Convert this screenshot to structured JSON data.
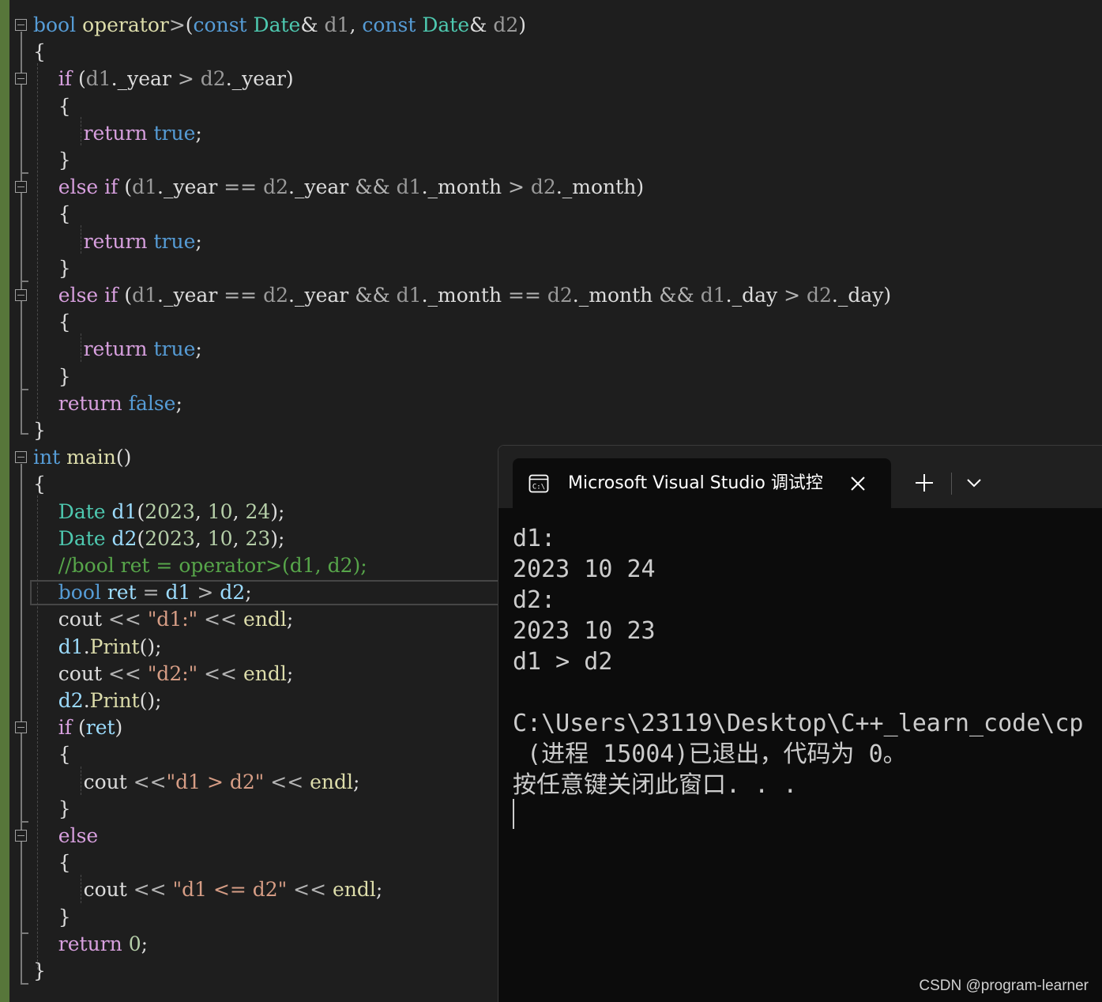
{
  "editor": {
    "lines": [
      [
        [
          "kw",
          "bool"
        ],
        [
          "plain",
          " "
        ],
        [
          "fn",
          "operator"
        ],
        [
          "op",
          ">"
        ],
        [
          "plain",
          "("
        ],
        [
          "kw",
          "const"
        ],
        [
          "plain",
          " "
        ],
        [
          "typ",
          "Date"
        ],
        [
          "plain",
          "& "
        ],
        [
          "par",
          "d1"
        ],
        [
          "plain",
          ", "
        ],
        [
          "kw",
          "const"
        ],
        [
          "plain",
          " "
        ],
        [
          "typ",
          "Date"
        ],
        [
          "plain",
          "& "
        ],
        [
          "par",
          "d2"
        ],
        [
          "plain",
          ")"
        ]
      ],
      [
        [
          "plain",
          "{"
        ]
      ],
      [
        [
          "plain",
          "    "
        ],
        [
          "ctl",
          "if"
        ],
        [
          "plain",
          " ("
        ],
        [
          "par",
          "d1"
        ],
        [
          "plain",
          "."
        ],
        [
          "plain",
          "_year"
        ],
        [
          "plain",
          " "
        ],
        [
          "op",
          ">"
        ],
        [
          "plain",
          " "
        ],
        [
          "par",
          "d2"
        ],
        [
          "plain",
          "."
        ],
        [
          "plain",
          "_year"
        ],
        [
          "plain",
          ")"
        ]
      ],
      [
        [
          "plain",
          "    {"
        ]
      ],
      [
        [
          "plain",
          "        "
        ],
        [
          "ctl",
          "return"
        ],
        [
          "plain",
          " "
        ],
        [
          "kw",
          "true"
        ],
        [
          "plain",
          ";"
        ]
      ],
      [
        [
          "plain",
          "    }"
        ]
      ],
      [
        [
          "plain",
          "    "
        ],
        [
          "ctl",
          "else"
        ],
        [
          "plain",
          " "
        ],
        [
          "ctl",
          "if"
        ],
        [
          "plain",
          " ("
        ],
        [
          "par",
          "d1"
        ],
        [
          "plain",
          "."
        ],
        [
          "plain",
          "_year"
        ],
        [
          "plain",
          " "
        ],
        [
          "op",
          "=="
        ],
        [
          "plain",
          " "
        ],
        [
          "par",
          "d2"
        ],
        [
          "plain",
          "."
        ],
        [
          "plain",
          "_year"
        ],
        [
          "plain",
          " "
        ],
        [
          "op",
          "&&"
        ],
        [
          "plain",
          " "
        ],
        [
          "par",
          "d1"
        ],
        [
          "plain",
          "."
        ],
        [
          "plain",
          "_month"
        ],
        [
          "plain",
          " "
        ],
        [
          "op",
          ">"
        ],
        [
          "plain",
          " "
        ],
        [
          "par",
          "d2"
        ],
        [
          "plain",
          "."
        ],
        [
          "plain",
          "_month"
        ],
        [
          "plain",
          ")"
        ]
      ],
      [
        [
          "plain",
          "    {"
        ]
      ],
      [
        [
          "plain",
          "        "
        ],
        [
          "ctl",
          "return"
        ],
        [
          "plain",
          " "
        ],
        [
          "kw",
          "true"
        ],
        [
          "plain",
          ";"
        ]
      ],
      [
        [
          "plain",
          "    }"
        ]
      ],
      [
        [
          "plain",
          "    "
        ],
        [
          "ctl",
          "else"
        ],
        [
          "plain",
          " "
        ],
        [
          "ctl",
          "if"
        ],
        [
          "plain",
          " ("
        ],
        [
          "par",
          "d1"
        ],
        [
          "plain",
          "."
        ],
        [
          "plain",
          "_year"
        ],
        [
          "plain",
          " "
        ],
        [
          "op",
          "=="
        ],
        [
          "plain",
          " "
        ],
        [
          "par",
          "d2"
        ],
        [
          "plain",
          "."
        ],
        [
          "plain",
          "_year"
        ],
        [
          "plain",
          " "
        ],
        [
          "op",
          "&&"
        ],
        [
          "plain",
          " "
        ],
        [
          "par",
          "d1"
        ],
        [
          "plain",
          "."
        ],
        [
          "plain",
          "_month"
        ],
        [
          "plain",
          " "
        ],
        [
          "op",
          "=="
        ],
        [
          "plain",
          " "
        ],
        [
          "par",
          "d2"
        ],
        [
          "plain",
          "."
        ],
        [
          "plain",
          "_month"
        ],
        [
          "plain",
          " "
        ],
        [
          "op",
          "&&"
        ],
        [
          "plain",
          " "
        ],
        [
          "par",
          "d1"
        ],
        [
          "plain",
          "."
        ],
        [
          "plain",
          "_day"
        ],
        [
          "plain",
          " "
        ],
        [
          "op",
          ">"
        ],
        [
          "plain",
          " "
        ],
        [
          "par",
          "d2"
        ],
        [
          "plain",
          "."
        ],
        [
          "plain",
          "_day"
        ],
        [
          "plain",
          ")"
        ]
      ],
      [
        [
          "plain",
          "    {"
        ]
      ],
      [
        [
          "plain",
          "        "
        ],
        [
          "ctl",
          "return"
        ],
        [
          "plain",
          " "
        ],
        [
          "kw",
          "true"
        ],
        [
          "plain",
          ";"
        ]
      ],
      [
        [
          "plain",
          "    }"
        ]
      ],
      [
        [
          "plain",
          "    "
        ],
        [
          "ctl",
          "return"
        ],
        [
          "plain",
          " "
        ],
        [
          "kw",
          "false"
        ],
        [
          "plain",
          ";"
        ]
      ],
      [
        [
          "plain",
          "}"
        ]
      ],
      [
        [
          "kw",
          "int"
        ],
        [
          "plain",
          " "
        ],
        [
          "fn",
          "main"
        ],
        [
          "plain",
          "()"
        ]
      ],
      [
        [
          "plain",
          "{"
        ]
      ],
      [
        [
          "plain",
          "    "
        ],
        [
          "typ",
          "Date"
        ],
        [
          "plain",
          " "
        ],
        [
          "var",
          "d1"
        ],
        [
          "plain",
          "("
        ],
        [
          "num",
          "2023"
        ],
        [
          "plain",
          ", "
        ],
        [
          "num",
          "10"
        ],
        [
          "plain",
          ", "
        ],
        [
          "num",
          "24"
        ],
        [
          "plain",
          ");"
        ]
      ],
      [
        [
          "plain",
          "    "
        ],
        [
          "typ",
          "Date"
        ],
        [
          "plain",
          " "
        ],
        [
          "var",
          "d2"
        ],
        [
          "plain",
          "("
        ],
        [
          "num",
          "2023"
        ],
        [
          "plain",
          ", "
        ],
        [
          "num",
          "10"
        ],
        [
          "plain",
          ", "
        ],
        [
          "num",
          "23"
        ],
        [
          "plain",
          ");"
        ]
      ],
      [
        [
          "cmt",
          "    //bool ret = operator>(d1, d2);"
        ]
      ],
      [
        [
          "plain",
          "    "
        ],
        [
          "kw",
          "bool"
        ],
        [
          "plain",
          " "
        ],
        [
          "var",
          "ret"
        ],
        [
          "plain",
          " "
        ],
        [
          "op",
          "="
        ],
        [
          "plain",
          " "
        ],
        [
          "var",
          "d1"
        ],
        [
          "plain",
          " "
        ],
        [
          "op",
          ">"
        ],
        [
          "plain",
          " "
        ],
        [
          "var",
          "d2"
        ],
        [
          "plain",
          ";"
        ]
      ],
      [
        [
          "plain",
          "    "
        ],
        [
          "plain",
          "cout"
        ],
        [
          "plain",
          " "
        ],
        [
          "op",
          "<<"
        ],
        [
          "plain",
          " "
        ],
        [
          "str",
          "\"d1:\""
        ],
        [
          "plain",
          " "
        ],
        [
          "op",
          "<<"
        ],
        [
          "plain",
          " "
        ],
        [
          "fn",
          "endl"
        ],
        [
          "plain",
          ";"
        ]
      ],
      [
        [
          "plain",
          "    "
        ],
        [
          "var",
          "d1"
        ],
        [
          "plain",
          "."
        ],
        [
          "fn",
          "Print"
        ],
        [
          "plain",
          "();"
        ]
      ],
      [
        [
          "plain",
          "    "
        ],
        [
          "plain",
          "cout"
        ],
        [
          "plain",
          " "
        ],
        [
          "op",
          "<<"
        ],
        [
          "plain",
          " "
        ],
        [
          "str",
          "\"d2:\""
        ],
        [
          "plain",
          " "
        ],
        [
          "op",
          "<<"
        ],
        [
          "plain",
          " "
        ],
        [
          "fn",
          "endl"
        ],
        [
          "plain",
          ";"
        ]
      ],
      [
        [
          "plain",
          "    "
        ],
        [
          "var",
          "d2"
        ],
        [
          "plain",
          "."
        ],
        [
          "fn",
          "Print"
        ],
        [
          "plain",
          "();"
        ]
      ],
      [
        [
          "plain",
          "    "
        ],
        [
          "ctl",
          "if"
        ],
        [
          "plain",
          " ("
        ],
        [
          "var",
          "ret"
        ],
        [
          "plain",
          ")"
        ]
      ],
      [
        [
          "plain",
          "    {"
        ]
      ],
      [
        [
          "plain",
          "        "
        ],
        [
          "plain",
          "cout"
        ],
        [
          "plain",
          " "
        ],
        [
          "op",
          "<<"
        ],
        [
          "str",
          "\"d1 > d2\""
        ],
        [
          "plain",
          " "
        ],
        [
          "op",
          "<<"
        ],
        [
          "plain",
          " "
        ],
        [
          "fn",
          "endl"
        ],
        [
          "plain",
          ";"
        ]
      ],
      [
        [
          "plain",
          "    }"
        ]
      ],
      [
        [
          "plain",
          "    "
        ],
        [
          "ctl",
          "else"
        ]
      ],
      [
        [
          "plain",
          "    {"
        ]
      ],
      [
        [
          "plain",
          "        "
        ],
        [
          "plain",
          "cout"
        ],
        [
          "plain",
          " "
        ],
        [
          "op",
          "<<"
        ],
        [
          "plain",
          " "
        ],
        [
          "str",
          "\"d1 <= d2\""
        ],
        [
          "plain",
          " "
        ],
        [
          "op",
          "<<"
        ],
        [
          "plain",
          " "
        ],
        [
          "fn",
          "endl"
        ],
        [
          "plain",
          ";"
        ]
      ],
      [
        [
          "plain",
          "    }"
        ]
      ],
      [
        [
          "plain",
          "    "
        ],
        [
          "ctl",
          "return"
        ],
        [
          "plain",
          " "
        ],
        [
          "num",
          "0"
        ],
        [
          "plain",
          ";"
        ]
      ],
      [
        [
          "plain",
          "}"
        ]
      ]
    ]
  },
  "terminal": {
    "tab_title": "Microsoft Visual Studio 调试控",
    "tab_icon": "console-app-icon",
    "close_icon": "close-icon",
    "new_tab_icon": "plus-icon",
    "dropdown_icon": "chevron-down-icon",
    "output": [
      "d1:",
      "2023 10 24",
      "d2:",
      "2023 10 23",
      "d1 > d2",
      "",
      "C:\\Users\\23119\\Desktop\\C++_learn_code\\cp",
      " (进程 15004)已退出，代码为 0。",
      "按任意键关闭此窗口. . ."
    ]
  },
  "watermark": "CSDN @program-learner",
  "colors": {
    "editor_bg": "#1e1e1e",
    "console_bg": "#0c0c0c",
    "keyword": "#569cd6",
    "control": "#d8a0df",
    "type": "#4ec9b0",
    "string": "#d69d85",
    "comment": "#57a64a",
    "change_bar": "#57763a"
  }
}
